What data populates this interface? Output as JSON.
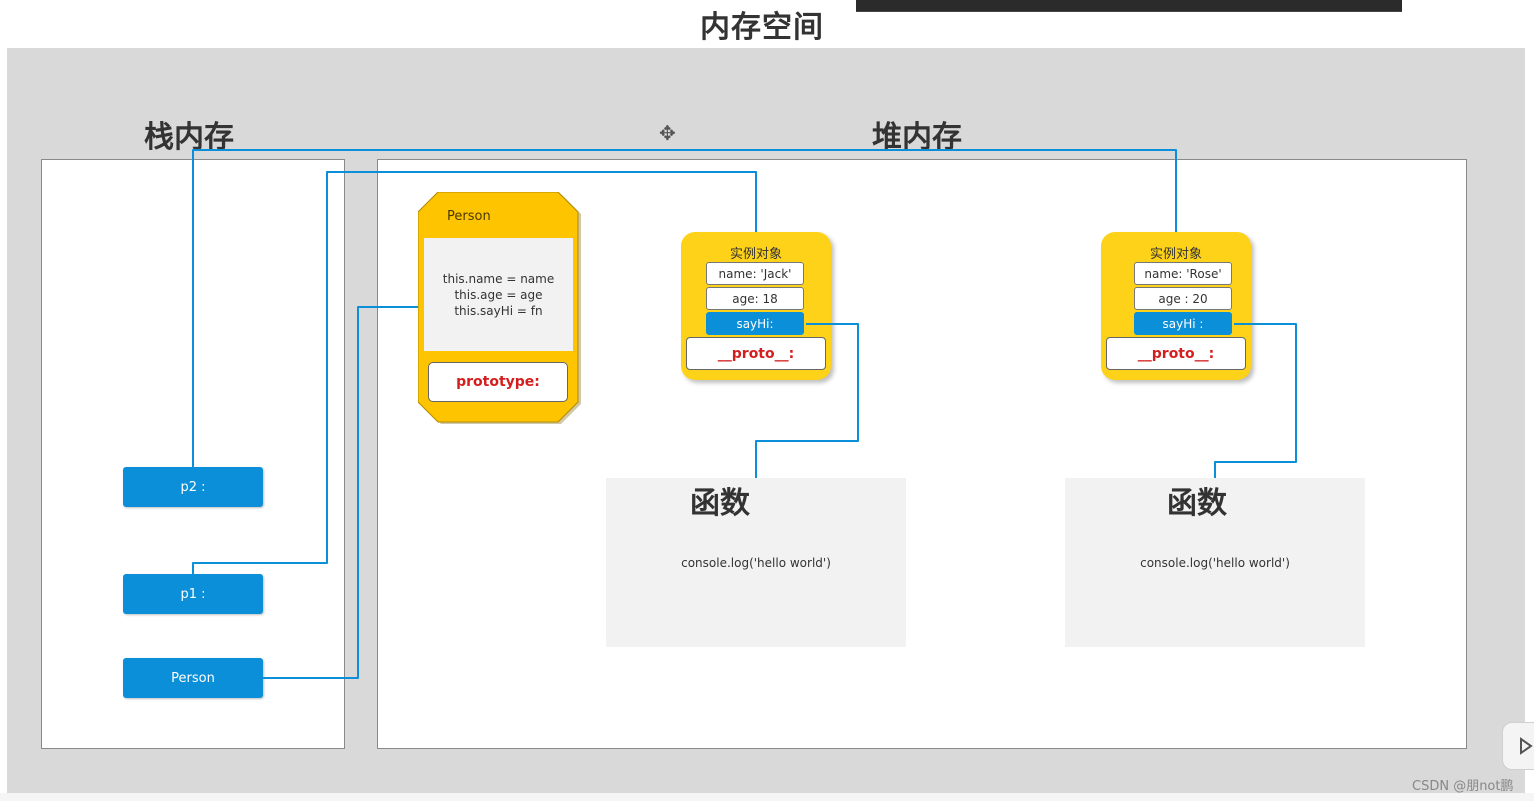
{
  "page": {
    "title": "内存空间",
    "watermark": "CSDN @朋not鹏"
  },
  "stack": {
    "title": "栈内存",
    "vars": {
      "p2": "p2 :",
      "p1": "p1 :",
      "person": "Person"
    }
  },
  "heap": {
    "title": "堆内存",
    "constructor": {
      "name": "Person",
      "body": [
        "this.name = name",
        "this.age = age",
        "this.sayHi = fn"
      ],
      "prototype": "prototype:"
    },
    "instance1": {
      "heading": "实例对象",
      "name": "name: 'Jack'",
      "age": "age: 18",
      "sayHi": "sayHi:",
      "proto": "__proto__:"
    },
    "instance2": {
      "heading": "实例对象",
      "name": "name: 'Rose'",
      "age": "age : 20",
      "sayHi": "sayHi :",
      "proto": "__proto__:"
    },
    "function1": {
      "title": "函数",
      "code": "console.log('hello  world')"
    },
    "function2": {
      "title": "函数",
      "code": "console.log('hello world')"
    }
  },
  "colors": {
    "connector": "#0a8fd8",
    "variable": "#0a8fd8",
    "card": "#ffd21a",
    "proto_text": "#d41e1e",
    "canvas": "#d9d9d9"
  },
  "icons": {
    "move": "move-icon",
    "side_button": "play-icon"
  }
}
